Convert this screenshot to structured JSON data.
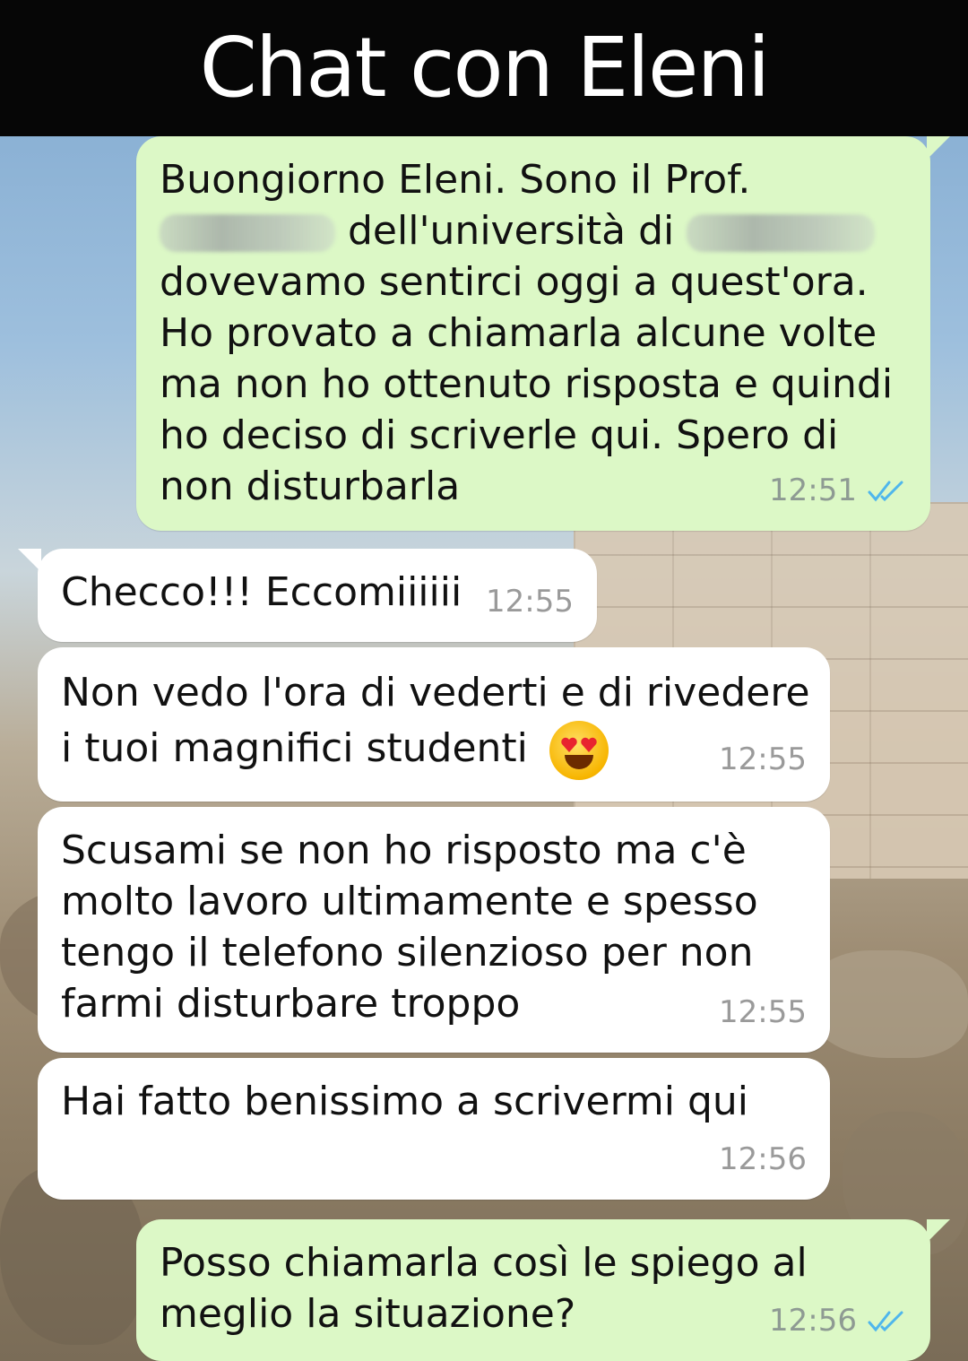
{
  "header": {
    "title": "Chat con Eleni"
  },
  "messages": [
    {
      "direction": "outgoing",
      "lines": [
        "Buongiorno Eleni. Sono il Prof.",
        "dell'università di",
        "dovevamo sentirci oggi a quest'ora.",
        "Ho provato a chiamarla alcune volte",
        "ma non ho ottenuto risposta e quindi",
        "ho deciso di scriverle qui. Spero di",
        "non disturbarla"
      ],
      "time": "12:51",
      "status": "read-double-check-icon"
    },
    {
      "direction": "incoming",
      "lines": [
        "Checco!!! Eccomiiiiii"
      ],
      "time": "12:55"
    },
    {
      "direction": "incoming",
      "lines": [
        "Non vedo l'ora di vederti e di rivedere",
        "i tuoi magnifici studenti"
      ],
      "emoji": "smiling-face-with-heart-eyes",
      "time": "12:55"
    },
    {
      "direction": "incoming",
      "lines": [
        "Scusami se non ho risposto ma c'è",
        "molto lavoro ultimamente e spesso",
        "tengo il telefono silenzioso per non",
        "farmi disturbare troppo"
      ],
      "time": "12:55"
    },
    {
      "direction": "incoming",
      "lines": [
        "Hai fatto benissimo a scrivermi qui"
      ],
      "time": "12:56"
    },
    {
      "direction": "outgoing",
      "lines": [
        "Posso chiamarla così le spiego al",
        "meglio la situazione?"
      ],
      "time": "12:56",
      "status": "read-double-check-icon"
    }
  ],
  "colors": {
    "outgoing_bubble": "#dcf8c6",
    "incoming_bubble": "#ffffff",
    "read_ticks": "#4fb6ec",
    "header_bg": "#060606"
  }
}
